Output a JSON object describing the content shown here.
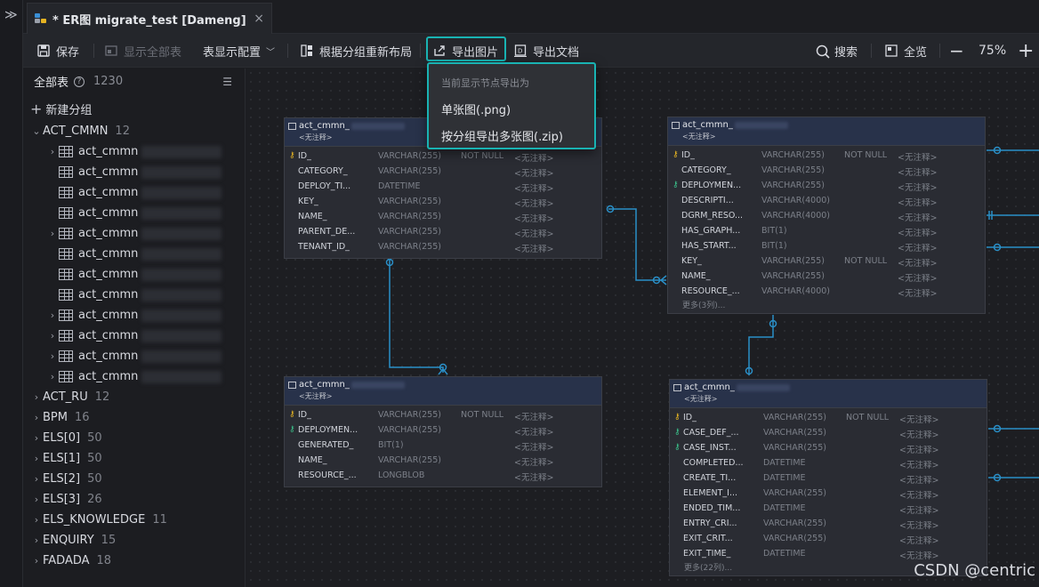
{
  "tab": {
    "title": "* ER图 migrate_test [Dameng]",
    "close": "×"
  },
  "toolbar": {
    "save": "保存",
    "show_all": "显示全部表",
    "table_display": "表显示配置",
    "relayout": "根据分组重新布局",
    "export_image": "导出图片",
    "export_doc": "导出文档",
    "search": "搜索",
    "overview": "全览",
    "zoom": "75%",
    "zoom_out": "−",
    "zoom_in": "+"
  },
  "dropdown": {
    "header": "当前显示节点导出为",
    "single": "单张图(.png)",
    "multi": "按分组导出多张图(.zip)"
  },
  "sidebar": {
    "title": "全部表",
    "count": "1230",
    "new_group": "新建分组",
    "groups": [
      {
        "name": "ACT_CMMN",
        "count": "12"
      },
      {
        "name": "ACT_RU",
        "count": "12"
      },
      {
        "name": "BPM",
        "count": "16"
      },
      {
        "name": "ELS[0]",
        "count": "50"
      },
      {
        "name": "ELS[1]",
        "count": "50"
      },
      {
        "name": "ELS[2]",
        "count": "50"
      },
      {
        "name": "ELS[3]",
        "count": "26"
      },
      {
        "name": "ELS_KNOWLEDGE",
        "count": "11"
      },
      {
        "name": "ENQUIRY",
        "count": "15"
      },
      {
        "name": "FADADA",
        "count": "18"
      }
    ],
    "table_prefix": "act_cmmn"
  },
  "tables": [
    {
      "name": "act_cmmn_",
      "comment": "<无注释>",
      "rows": [
        [
          "ID_",
          "VARCHAR(255)",
          "NOT NULL",
          "<无注释>"
        ],
        [
          "CATEGORY_",
          "VARCHAR(255)",
          "",
          "<无注释>"
        ],
        [
          "DEPLOY_TI...",
          "DATETIME",
          "",
          "<无注释>"
        ],
        [
          "KEY_",
          "VARCHAR(255)",
          "",
          "<无注释>"
        ],
        [
          "NAME_",
          "VARCHAR(255)",
          "",
          "<无注释>"
        ],
        [
          "PARENT_DE...",
          "VARCHAR(255)",
          "",
          "<无注释>"
        ],
        [
          "TENANT_ID_",
          "VARCHAR(255)",
          "",
          "<无注释>"
        ]
      ]
    },
    {
      "name": "act_cmmn_",
      "comment": "<无注释>",
      "rows": [
        [
          "ID_",
          "VARCHAR(255)",
          "NOT NULL",
          "<无注释>"
        ],
        [
          "CATEGORY_",
          "VARCHAR(255)",
          "",
          "<无注释>"
        ],
        [
          "DEPLOYMEN...",
          "VARCHAR(255)",
          "",
          "<无注释>"
        ],
        [
          "DESCRIPTI...",
          "VARCHAR(4000)",
          "",
          "<无注释>"
        ],
        [
          "DGRM_RESO...",
          "VARCHAR(4000)",
          "",
          "<无注释>"
        ],
        [
          "HAS_GRAPH...",
          "BIT(1)",
          "",
          "<无注释>"
        ],
        [
          "HAS_START...",
          "BIT(1)",
          "",
          "<无注释>"
        ],
        [
          "KEY_",
          "VARCHAR(255)",
          "NOT NULL",
          "<无注释>"
        ],
        [
          "NAME_",
          "VARCHAR(255)",
          "",
          "<无注释>"
        ],
        [
          "RESOURCE_...",
          "VARCHAR(4000)",
          "",
          "<无注释>"
        ]
      ],
      "more": "更多(3列)..."
    },
    {
      "name": "act_cmmn_",
      "comment": "<无注释>",
      "rows": [
        [
          "ID_",
          "VARCHAR(255)",
          "NOT NULL",
          "<无注释>"
        ],
        [
          "DEPLOYMEN...",
          "VARCHAR(255)",
          "",
          "<无注释>"
        ],
        [
          "GENERATED_",
          "BIT(1)",
          "",
          "<无注释>"
        ],
        [
          "NAME_",
          "VARCHAR(255)",
          "",
          "<无注释>"
        ],
        [
          "RESOURCE_...",
          "LONGBLOB",
          "",
          "<无注释>"
        ]
      ]
    },
    {
      "name": "act_cmmn_",
      "comment": "<无注释>",
      "rows": [
        [
          "ID_",
          "VARCHAR(255)",
          "NOT NULL",
          "<无注释>"
        ],
        [
          "CASE_DEF_...",
          "VARCHAR(255)",
          "",
          "<无注释>"
        ],
        [
          "CASE_INST...",
          "VARCHAR(255)",
          "",
          "<无注释>"
        ],
        [
          "COMPLETED...",
          "DATETIME",
          "",
          "<无注释>"
        ],
        [
          "CREATE_TI...",
          "DATETIME",
          "",
          "<无注释>"
        ],
        [
          "ELEMENT_I...",
          "VARCHAR(255)",
          "",
          "<无注释>"
        ],
        [
          "ENDED_TIM...",
          "DATETIME",
          "",
          "<无注释>"
        ],
        [
          "ENTRY_CRI...",
          "VARCHAR(255)",
          "",
          "<无注释>"
        ],
        [
          "EXIT_CRIT...",
          "VARCHAR(255)",
          "",
          "<无注释>"
        ],
        [
          "EXIT_TIME_",
          "DATETIME",
          "",
          "<无注释>"
        ]
      ],
      "more": "更多(22列)..."
    }
  ],
  "watermark": "CSDN @centric",
  "colors": {
    "accent": "#19b3b3",
    "pk": "#e6b422",
    "fk": "#3ac08a",
    "link": "#2a8fc7"
  }
}
